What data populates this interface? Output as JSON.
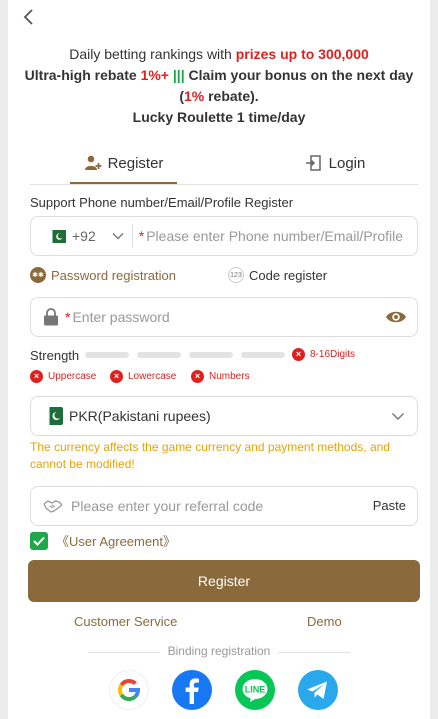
{
  "promo": {
    "line1_text": "Daily betting rankings with ",
    "line1_highlight": "prizes up to 300,000",
    "line2_text1": "Ultra-high rebate ",
    "line2_highlight": "1%+",
    "line2_bars": "|||",
    "line2_text2": " Claim your bonus on the next day",
    "line3_open": "(",
    "line3_highlight": "1%",
    "line3_close": " rebate).",
    "line4": "Lucky Roulette 1 time/day"
  },
  "tabs": {
    "register": "Register",
    "login": "Login"
  },
  "form": {
    "support_label": "Support Phone number/Email/Profile Register",
    "country_code": "+92",
    "required_mark": "*",
    "phone_placeholder": "Please enter Phone number/Email/Profile",
    "password_registration": "Password registration",
    "code_register": "Code register",
    "password_placeholder": "Enter password",
    "strength_label": "Strength",
    "rules": {
      "digits": "8-16Digits",
      "uppercase": "Uppercase",
      "lowercase": "Lowercase",
      "numbers": "Numbers"
    },
    "currency_value": "PKR(Pakistani rupees)",
    "currency_note": "The currency affects the game currency and payment methods, and cannot be modified!",
    "referral_placeholder": "Please enter your referral code",
    "paste": "Paste",
    "user_agreement": "《User Agreement》",
    "agreement_checked": true,
    "register_button": "Register"
  },
  "links": {
    "customer_service": "Customer Service",
    "demo": "Demo"
  },
  "binding": {
    "label": "Binding registration",
    "providers": [
      "google",
      "facebook",
      "line",
      "telegram"
    ]
  },
  "colors": {
    "brand": "#8a6a3c",
    "error": "#e02020",
    "warning": "#e6a400",
    "success": "#1fa84a"
  }
}
